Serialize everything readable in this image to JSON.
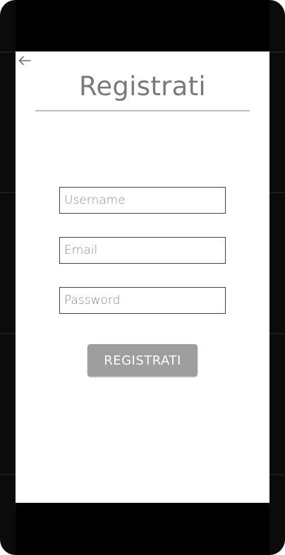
{
  "header": {
    "title": "Registrati",
    "back_icon": "arrow-back-icon"
  },
  "form": {
    "username_placeholder": "Username",
    "username_value": "",
    "email_placeholder": "Email",
    "email_value": "",
    "password_placeholder": "Password",
    "password_value": "",
    "submit_label": "REGISTRATI"
  },
  "colors": {
    "title": "#7a7a7a",
    "button_bg": "#9e9e9e",
    "button_text": "#ffffff",
    "divider": "#bfbfbf",
    "frame": "#000000"
  }
}
